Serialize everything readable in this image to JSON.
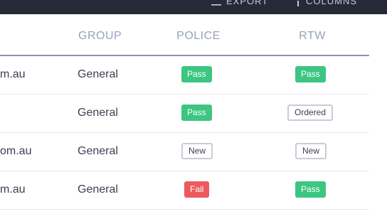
{
  "toolbar": {
    "export_label": "EXPORT",
    "columns_label": "COLUMNS"
  },
  "table": {
    "headers": {
      "group": "GROUP",
      "police": "POLICE",
      "rtw": "RTW"
    },
    "rows": [
      {
        "email": "m.au",
        "group": "General",
        "police": "Pass",
        "rtw": "Pass"
      },
      {
        "email": "",
        "group": "General",
        "police": "Pass",
        "rtw": "Ordered"
      },
      {
        "email": "om.au",
        "group": "General",
        "police": "New",
        "rtw": "New"
      },
      {
        "email": "m.au",
        "group": "General",
        "police": "Fail",
        "rtw": "Pass"
      }
    ]
  },
  "colors": {
    "pass": "#3cc681",
    "fail": "#ec5a5e",
    "header_bar": "#262a37",
    "header_text": "#98a2bd"
  }
}
